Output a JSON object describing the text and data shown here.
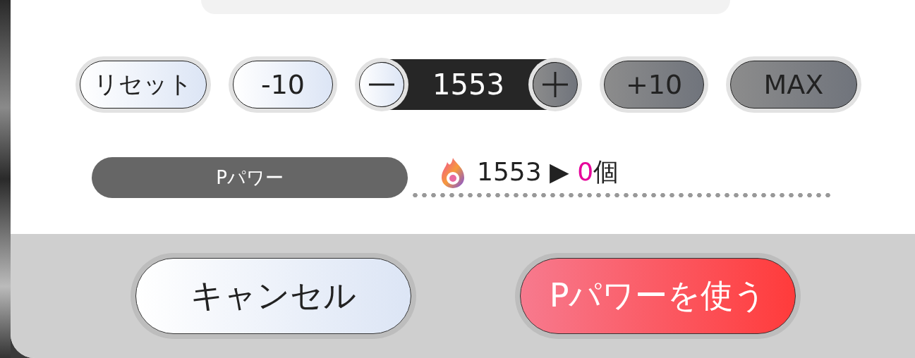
{
  "controls": [
    {
      "kind": "button",
      "label": "リセット",
      "disabled": false
    },
    {
      "kind": "button",
      "label": "-10",
      "disabled": false
    },
    {
      "kind": "stepper",
      "value": "1553",
      "decrement_disabled": false,
      "increment_disabled": true
    },
    {
      "kind": "button",
      "label": "+10",
      "disabled": true
    },
    {
      "kind": "button",
      "label": "MAX",
      "disabled": true
    }
  ],
  "resource": {
    "label": "Pパワー",
    "current": "1553",
    "arrow": "▶",
    "result": "0",
    "unit": "個"
  },
  "footer_buttons": [
    {
      "kind": "secondary",
      "label": "キャンセル"
    },
    {
      "kind": "primary",
      "label": "Pパワーを使う"
    }
  ]
}
